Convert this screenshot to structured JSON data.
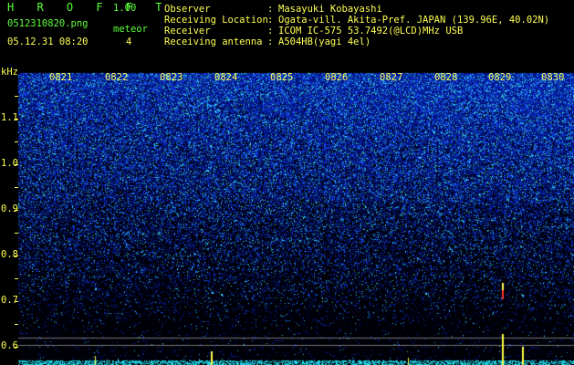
{
  "header": {
    "app_title": "H R O F F T",
    "version": "1.00",
    "filename": "0512310820.png",
    "datetime": "05.12.31 08:20",
    "meteor_label": "meteor",
    "meteor_count": "4",
    "info": [
      {
        "key": "Observer",
        "sep": ":",
        "value": "Masayuki Kobayashi"
      },
      {
        "key": "Receiving Location",
        "sep": ":",
        "value": "Ogata-vill. Akita-Pref. JAPAN (139.96E, 40.02N)"
      },
      {
        "key": "Receiver",
        "sep": ":",
        "value": "ICOM IC-575 53.7492(@LCD)MHz USB"
      },
      {
        "key": "Receiving antenna",
        "sep": ":",
        "value": "A504HB(yagi 4el)"
      }
    ]
  },
  "axis": {
    "unit": "kHz",
    "labels": [
      "1.1",
      "1.0",
      "0.9",
      "0.8",
      "0.7",
      "0.6"
    ]
  },
  "time_labels": [
    "0821",
    "0822",
    "0823",
    "0824",
    "0825",
    "0826",
    "0827",
    "0828",
    "0829",
    "0830"
  ],
  "colors": {
    "header_green": "#5cff3a",
    "header_yellow": "#ffff55",
    "noise_blue": "#1a2fd0",
    "noise_cyan": "#40e0ff"
  }
}
